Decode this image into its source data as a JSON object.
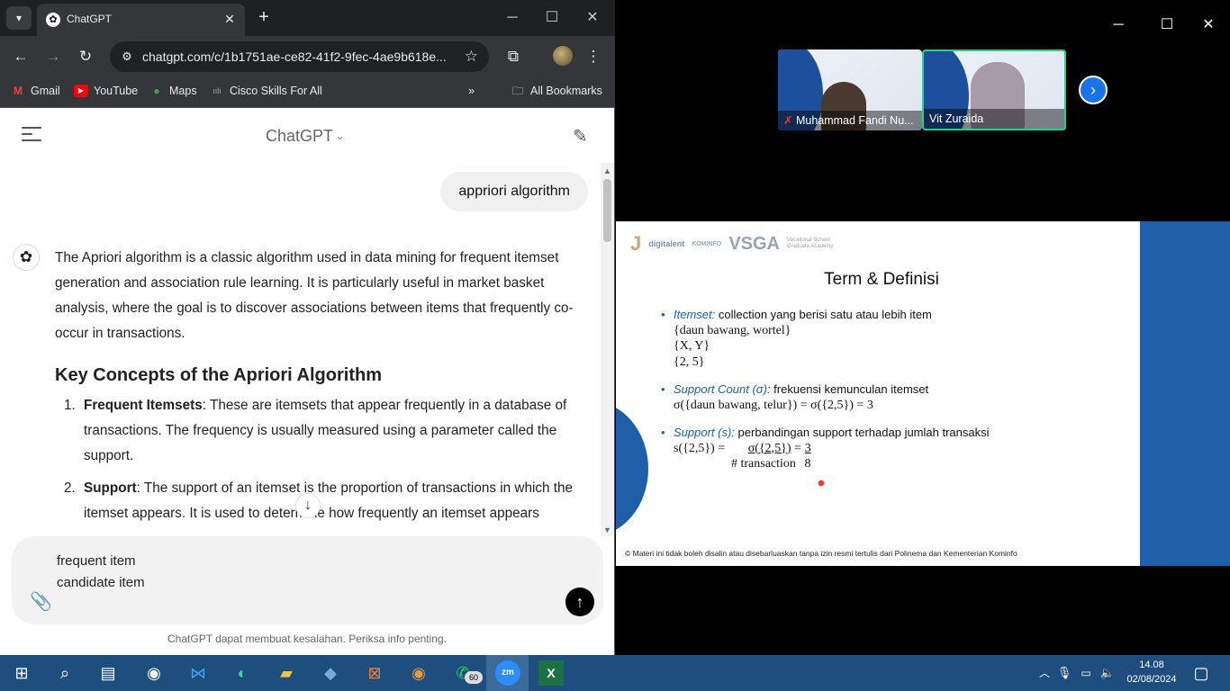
{
  "browser": {
    "tab_title": "ChatGPT",
    "url": "chatgpt.com/c/1b1751ae-ce82-41f2-9fec-4ae9b618e...",
    "bookmarks": [
      "Gmail",
      "YouTube",
      "Maps",
      "Cisco Skills For All"
    ],
    "all_bookmarks_label": "All Bookmarks"
  },
  "chat": {
    "model_name": "ChatGPT",
    "user_message": "appriori algorithm",
    "intro": "The Apriori algorithm is a classic algorithm used in data mining for frequent itemset generation and association rule learning. It is particularly useful in market basket analysis, where the goal is to discover associations between items that frequently co-occur in transactions.",
    "heading": "Key Concepts of the Apriori Algorithm",
    "items": [
      {
        "num": "1.",
        "term": "Frequent Itemsets",
        "text": ": These are itemsets that appear frequently in a database of transactions. The frequency is usually measured using a parameter called the support."
      },
      {
        "num": "2.",
        "term": "Support",
        "text": ": The support of an itemset is the proportion of transactions in which the itemset appears. It is used to determine how frequently an itemset appears"
      }
    ],
    "composer_text": "frequent item\ncandidate item",
    "disclaimer": "ChatGPT dapat membuat kesalahan. Periksa info penting."
  },
  "zoom": {
    "participants": [
      {
        "name": "Muhammad Fandi Nu..."
      },
      {
        "name": "Vit Zuraida"
      }
    ],
    "slide": {
      "logos": [
        "digitalent",
        "KOMINFO",
        "VSGA"
      ],
      "logo_sub": "Vocational School Graduate Academy",
      "title": "Term & Definisi",
      "itemset_term": "Itemset:",
      "itemset_def": " collection yang berisi satu atau lebih item",
      "itemset_ex1": "{daun bawang, wortel}",
      "itemset_ex2": "{X, Y}",
      "itemset_ex3": "{2, 5}",
      "support_count_term": "Support Count (σ):",
      "support_count_def": " frekuensi kemunculan itemset",
      "support_count_ex": "σ({daun bawang, telur}) = σ({2,5}) = 3",
      "support_term": "Support (s):",
      "support_def": " perbandingan support terhadap jumlah transaksi",
      "support_formula_top": "s({2,5}) =",
      "support_formula_num": "σ({2,5})",
      "support_formula_eq": "=",
      "support_formula_val": "3",
      "support_formula_den": "# transaction",
      "support_formula_den_val": "8",
      "footer": "Materi ini tidak boleh disalin atau disebarluaskan tanpa izin resmi tertulis dari Polinema dan Kementerian Kominfo"
    }
  },
  "taskbar": {
    "badge": "60",
    "time": "14.08",
    "date": "02/08/2024"
  }
}
